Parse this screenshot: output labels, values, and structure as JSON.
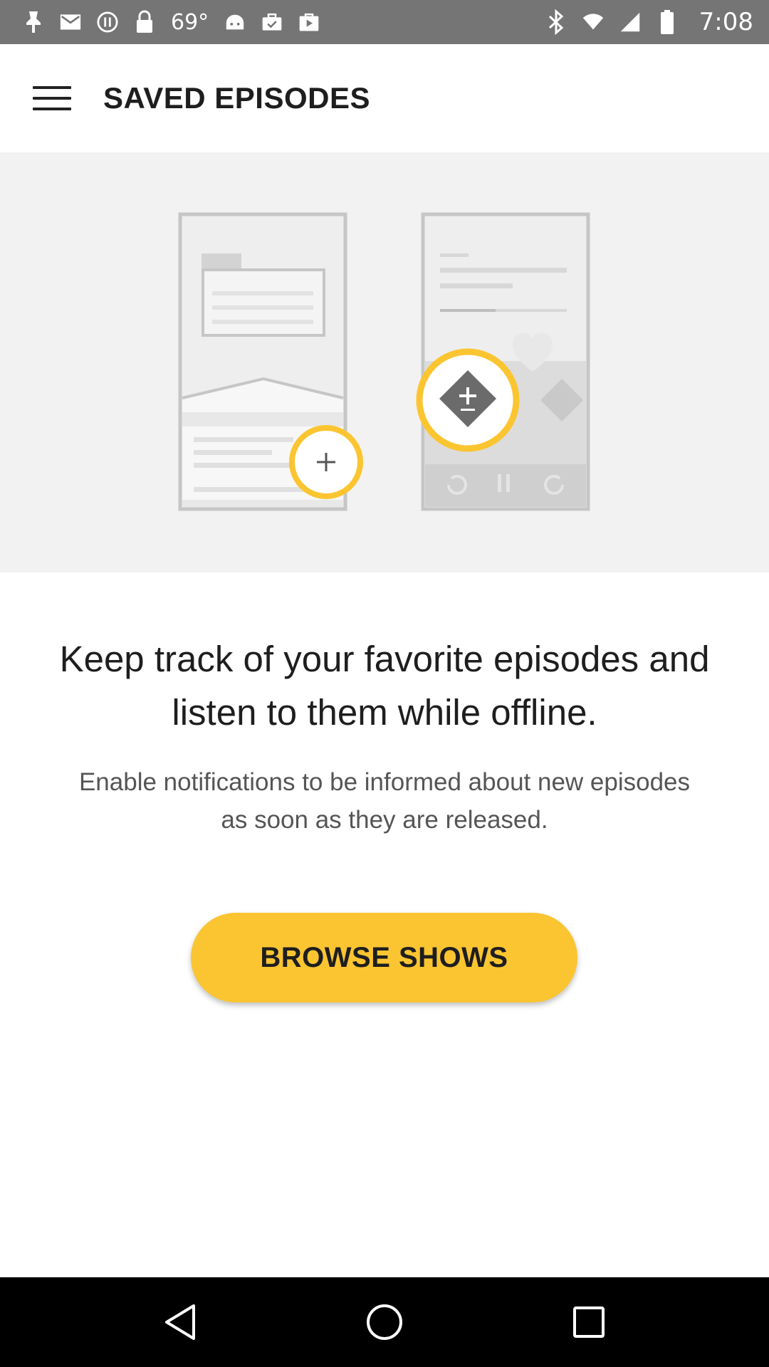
{
  "status_bar": {
    "temperature": "69°",
    "time": "7:08",
    "left_icons": [
      "notification-pin-icon",
      "mail-icon",
      "pause-circle-icon",
      "lock-icon",
      "android-icon",
      "briefcase-check-icon",
      "play-store-icon"
    ],
    "right_icons": [
      "bluetooth-icon",
      "wifi-icon",
      "signal-icon",
      "battery-icon"
    ]
  },
  "app_bar": {
    "title": "SAVED EPISODES",
    "menu_icon": "hamburger-menu-icon"
  },
  "content": {
    "headline": "Keep track of your favorite episodes and listen to them while offline.",
    "subtext": "Enable notifications to be informed about new episodes as soon as they are released.",
    "browse_button_label": "BROWSE SHOWS"
  },
  "nav_bar": {
    "buttons": [
      "back-icon",
      "home-icon",
      "recents-icon"
    ]
  },
  "colors": {
    "accent": "#fbc531",
    "status_bar": "#757575",
    "illustration_bg": "#f2f2f2",
    "nav_bar": "#000000"
  }
}
